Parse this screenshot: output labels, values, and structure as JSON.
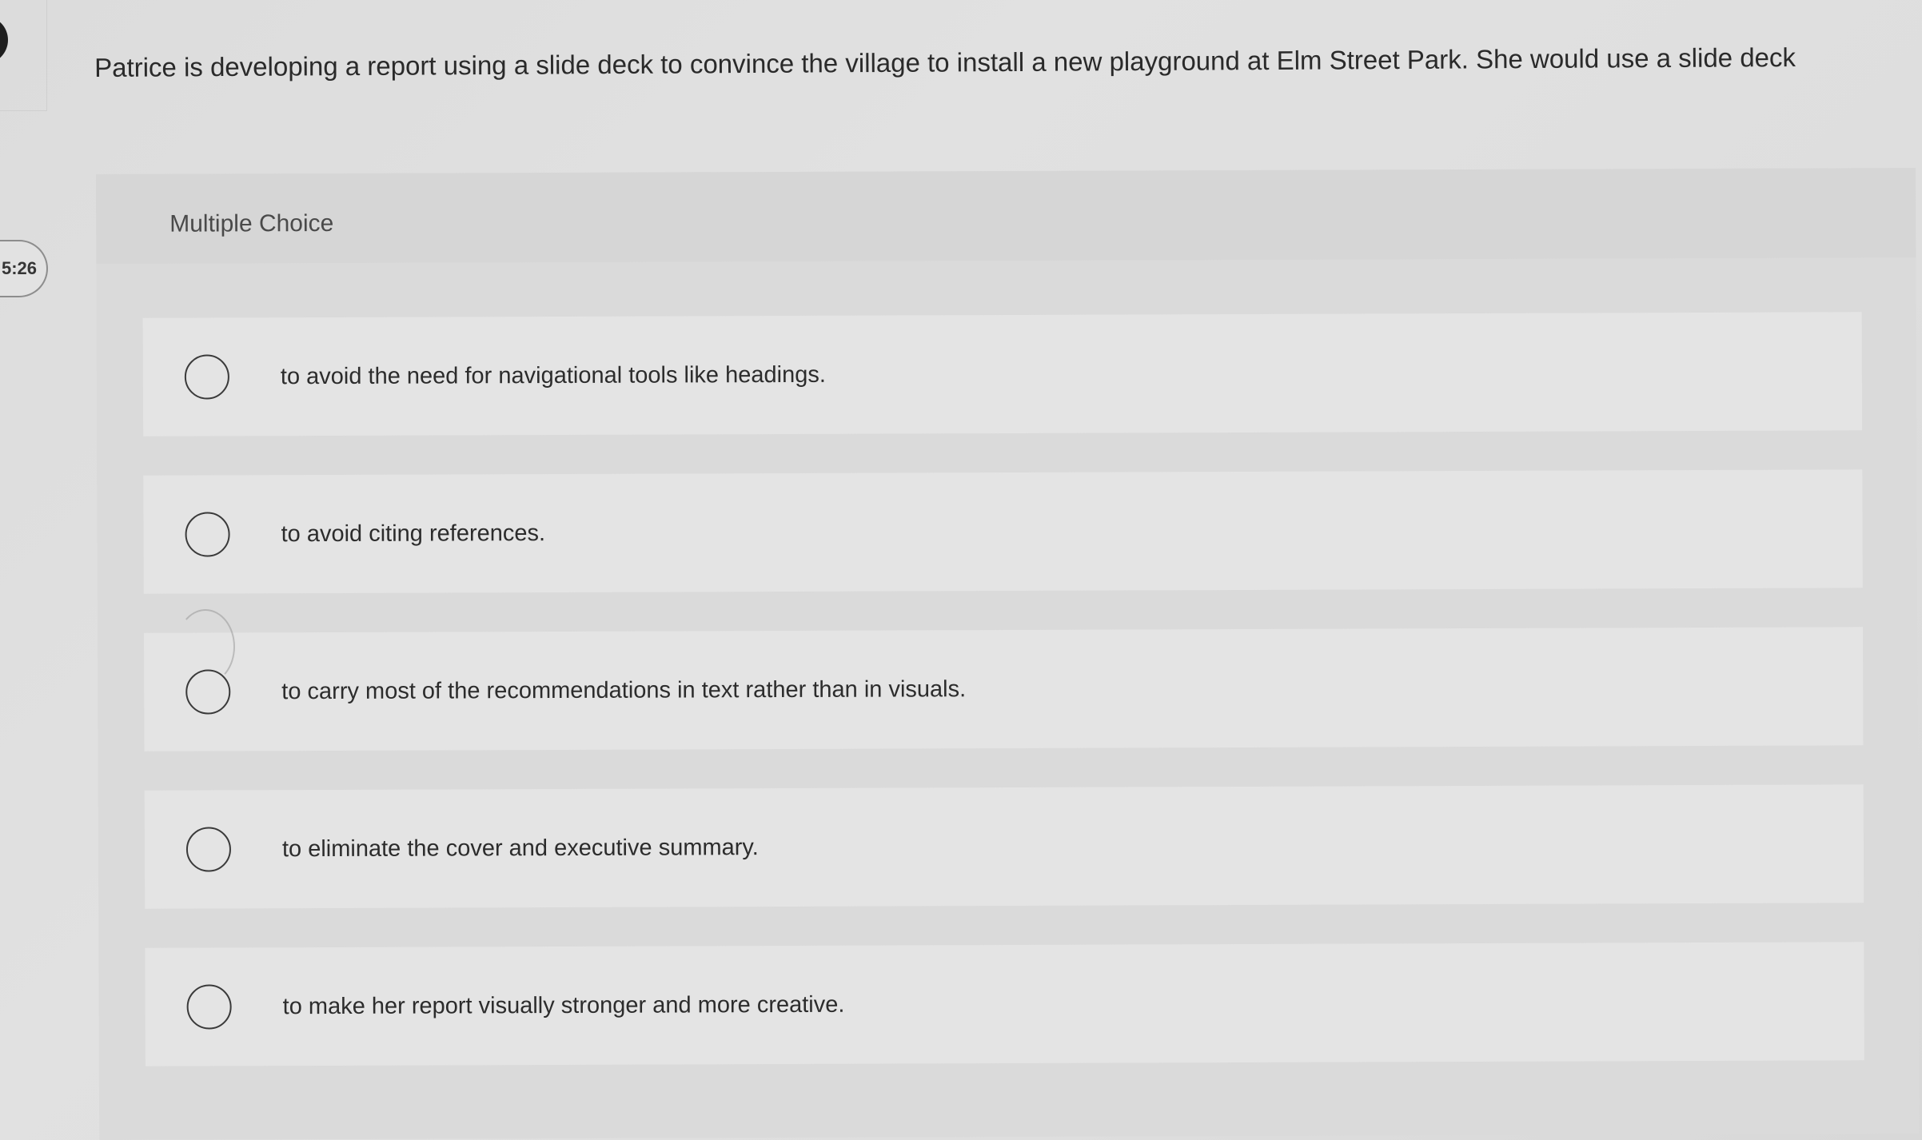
{
  "timer": {
    "text": "5:26"
  },
  "question": {
    "text": "Patrice is developing a report using a slide deck to convince the village to install a new playground at Elm Street Park. She would use a slide deck"
  },
  "panel": {
    "type_label": "Multiple Choice"
  },
  "options": [
    {
      "label": "to avoid the need for navigational tools like headings.",
      "selected": false
    },
    {
      "label": "to avoid citing references.",
      "selected": false
    },
    {
      "label": "to carry most of the recommendations in text rather than in visuals.",
      "selected": false
    },
    {
      "label": "to eliminate the cover and executive summary.",
      "selected": false
    },
    {
      "label": "to make her report visually stronger and more creative.",
      "selected": false
    }
  ]
}
